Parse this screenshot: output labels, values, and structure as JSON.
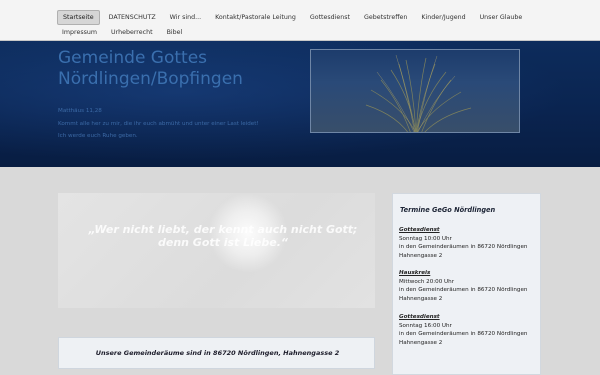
{
  "nav": {
    "row1": [
      "Startseite",
      "DATENSCHUTZ",
      "Wir sind...",
      "Kontakt/Pastorale Leitung",
      "Gottesdienst",
      "Gebetstreffen",
      "Kinder/Jugend",
      "Unser Glaube"
    ],
    "row2": [
      "Impressum",
      "Urheberrecht",
      "Bibel"
    ],
    "active": "Startseite"
  },
  "header": {
    "title_line1": "Gemeinde Gottes",
    "title_line2": "Nördlingen/Bopfingen",
    "verse_ref": "Matthäus 11,28",
    "verse_line1": "Kommt alle her zu mir, die ihr euch abmüht und unter einer Last leidet!",
    "verse_line2": "Ich werde euch Ruhe geben."
  },
  "main": {
    "quote": "„Wer nicht liebt, der kennt auch nicht Gott; denn Gott ist Liebe.“",
    "address_note": "Unsere Gemeinderäume sind in 86720 Nördlingen, Hahnengasse 2"
  },
  "sidebar": {
    "title": "Termine GeGo Nördlingen",
    "events": [
      {
        "title": "Gottesdienst",
        "time": "Sonntag 10:00 Uhr",
        "place": "in den Gemeinderäumen in 86720 Nördlingen",
        "street": "Hahnengasse 2"
      },
      {
        "title": "Hauskreis",
        "time": "Mittwoch 20:00 Uhr",
        "place": "in den Gemeinderäumen in 86720 Nördlingen",
        "street": "Hahnengasse 2"
      },
      {
        "title": "Gottesdienst",
        "time": "Sonntag 16:00 Uhr",
        "place": "in den Gemeinderäumen in 86720 Nördlingen",
        "street": "Hahnengasse 2"
      }
    ]
  }
}
